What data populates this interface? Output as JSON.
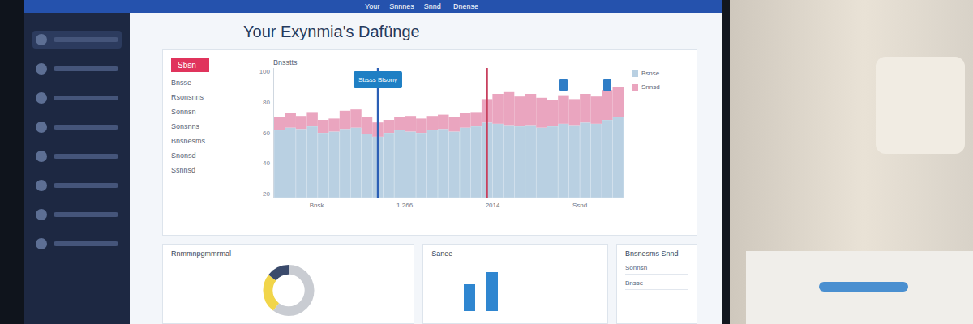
{
  "window": {
    "title": "Your Exynmia's Dafünge"
  },
  "topbar": {
    "links": [
      "Your",
      "Snnnes",
      "Snnd"
    ],
    "center": "Dnense"
  },
  "sidebar": {
    "items": [
      {
        "selected": true
      },
      {
        "selected": false
      },
      {
        "selected": false
      },
      {
        "selected": false
      },
      {
        "selected": false
      },
      {
        "selected": false
      },
      {
        "selected": false
      },
      {
        "selected": false
      }
    ]
  },
  "filter_list": {
    "tag": "Sbsn",
    "items": [
      "Bnsse",
      "Rsonsnns",
      "Sonnsn",
      "Sonsnns",
      "Bnsnesms",
      "Snonsd",
      "Ssnnsd"
    ]
  },
  "chart": {
    "title": "Bnsstts",
    "y_ticks": [
      "100",
      "80",
      "60",
      "40",
      "20"
    ],
    "x_labels": [
      "Bnsk",
      "1 266",
      "2014",
      "Ssnd"
    ],
    "series": [
      {
        "name": "Bsnse",
        "color": "#b9d0e2",
        "values": [
          52,
          54,
          53,
          55,
          50,
          51,
          53,
          54,
          49,
          47,
          50,
          52,
          51,
          50,
          52,
          53,
          51,
          54,
          55,
          58,
          57,
          56,
          55,
          56,
          54,
          55,
          57,
          56,
          58,
          57,
          60,
          62
        ]
      },
      {
        "name": "Snnsd",
        "color": "#eaa5bf",
        "values": [
          62,
          65,
          63,
          66,
          60,
          61,
          67,
          68,
          62,
          58,
          60,
          62,
          63,
          61,
          63,
          64,
          62,
          65,
          66,
          76,
          80,
          82,
          78,
          80,
          77,
          75,
          79,
          76,
          80,
          78,
          83,
          85
        ]
      }
    ],
    "lines": [
      {
        "index": 9,
        "color": "#2b5fb5"
      },
      {
        "index": 19,
        "color": "#c8405e"
      }
    ],
    "tooltips": [
      {
        "index": 9,
        "label": "Sbsss Blsony"
      }
    ],
    "pins": [
      {
        "index": 26
      },
      {
        "index": 30
      }
    ]
  },
  "donut_card": {
    "title": "Rnmmnpgmmrmal",
    "segments": [
      {
        "value": 60,
        "color": "#c9ccd2"
      },
      {
        "value": 25,
        "color": "#f1d54a"
      },
      {
        "value": 15,
        "color": "#3a4a6b"
      }
    ]
  },
  "bar_card": {
    "title": "Sanee",
    "values": [
      55,
      80
    ]
  },
  "side_panel": {
    "title": "Bnsnesms Snnd",
    "rows": [
      "Sonnsn",
      "Bnsse"
    ]
  }
}
